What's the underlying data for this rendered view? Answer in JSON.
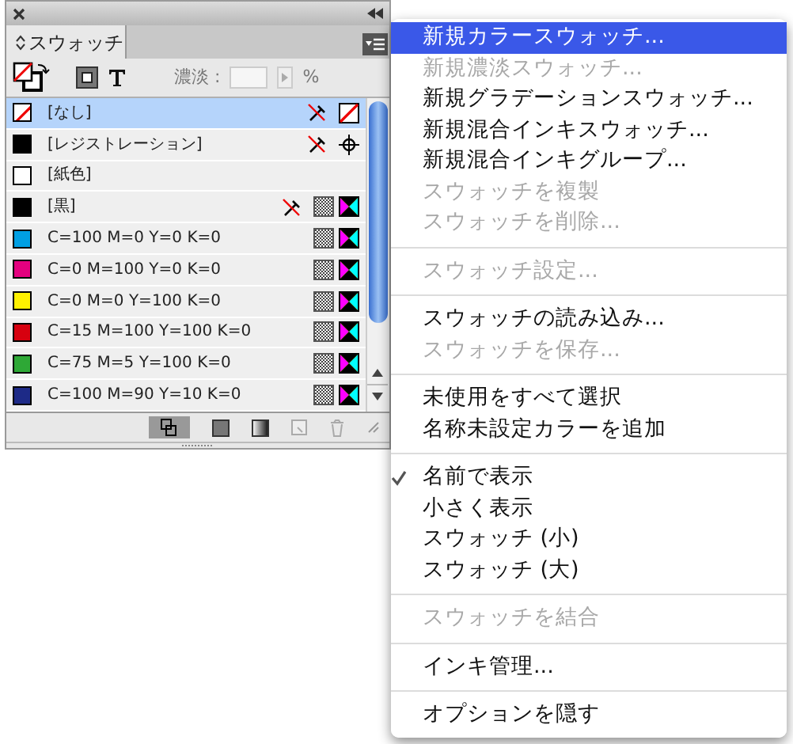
{
  "panel": {
    "tab": "スウォッチ",
    "tint_label": "濃淡 :",
    "tint_unit": "%",
    "swatches": [
      {
        "name": "[なし]",
        "kind": "none",
        "color": "#ffffff",
        "selected": true,
        "locked": true
      },
      {
        "name": "[レジストレーション]",
        "kind": "registration",
        "color": "#000000",
        "selected": false,
        "locked": true
      },
      {
        "name": "[紙色]",
        "kind": "paper",
        "color": "#ffffff",
        "selected": false,
        "locked": false
      },
      {
        "name": "[黒]",
        "kind": "process",
        "color": "#000000",
        "selected": false,
        "locked": true
      },
      {
        "name": "C=100 M=0 Y=0 K=0",
        "kind": "process",
        "color": "#009fe3",
        "selected": false,
        "locked": false
      },
      {
        "name": "C=0 M=100 Y=0 K=0",
        "kind": "process",
        "color": "#e4007f",
        "selected": false,
        "locked": false
      },
      {
        "name": "C=0 M=0 Y=100 K=0",
        "kind": "process",
        "color": "#fff100",
        "selected": false,
        "locked": false
      },
      {
        "name": "C=15 M=100 Y=100 K=0",
        "kind": "process",
        "color": "#d7000f",
        "selected": false,
        "locked": false
      },
      {
        "name": "C=75 M=5 Y=100 K=0",
        "kind": "process",
        "color": "#2ea836",
        "selected": false,
        "locked": false
      },
      {
        "name": "C=100 M=90 Y=10 K=0",
        "kind": "process",
        "color": "#1d2a87",
        "selected": false,
        "locked": false
      }
    ]
  },
  "menu": [
    {
      "kind": "item",
      "label": "新規カラースウォッチ...",
      "selected": true,
      "disabled": false,
      "checked": false
    },
    {
      "kind": "item",
      "label": "新規濃淡スウォッチ...",
      "selected": false,
      "disabled": true,
      "checked": false
    },
    {
      "kind": "item",
      "label": "新規グラデーションスウォッチ...",
      "selected": false,
      "disabled": false,
      "checked": false
    },
    {
      "kind": "item",
      "label": "新規混合インキスウォッチ...",
      "selected": false,
      "disabled": false,
      "checked": false
    },
    {
      "kind": "item",
      "label": "新規混合インキグループ...",
      "selected": false,
      "disabled": false,
      "checked": false
    },
    {
      "kind": "item",
      "label": "スウォッチを複製",
      "selected": false,
      "disabled": true,
      "checked": false
    },
    {
      "kind": "item",
      "label": "スウォッチを削除...",
      "selected": false,
      "disabled": true,
      "checked": false
    },
    {
      "kind": "separator"
    },
    {
      "kind": "item",
      "label": "スウォッチ設定...",
      "selected": false,
      "disabled": true,
      "checked": false
    },
    {
      "kind": "separator"
    },
    {
      "kind": "item",
      "label": "スウォッチの読み込み...",
      "selected": false,
      "disabled": false,
      "checked": false
    },
    {
      "kind": "item",
      "label": "スウォッチを保存...",
      "selected": false,
      "disabled": true,
      "checked": false
    },
    {
      "kind": "separator"
    },
    {
      "kind": "item",
      "label": "未使用をすべて選択",
      "selected": false,
      "disabled": false,
      "checked": false
    },
    {
      "kind": "item",
      "label": "名称未設定カラーを追加",
      "selected": false,
      "disabled": false,
      "checked": false
    },
    {
      "kind": "separator"
    },
    {
      "kind": "item",
      "label": "名前で表示",
      "selected": false,
      "disabled": false,
      "checked": true
    },
    {
      "kind": "item",
      "label": "小さく表示",
      "selected": false,
      "disabled": false,
      "checked": false
    },
    {
      "kind": "item",
      "label": "スウォッチ (小)",
      "selected": false,
      "disabled": false,
      "checked": false
    },
    {
      "kind": "item",
      "label": "スウォッチ (大)",
      "selected": false,
      "disabled": false,
      "checked": false
    },
    {
      "kind": "separator"
    },
    {
      "kind": "item",
      "label": "スウォッチを結合",
      "selected": false,
      "disabled": true,
      "checked": false
    },
    {
      "kind": "separator"
    },
    {
      "kind": "item",
      "label": "インキ管理...",
      "selected": false,
      "disabled": false,
      "checked": false
    },
    {
      "kind": "separator"
    },
    {
      "kind": "item",
      "label": "オプションを隠す",
      "selected": false,
      "disabled": false,
      "checked": false
    }
  ]
}
